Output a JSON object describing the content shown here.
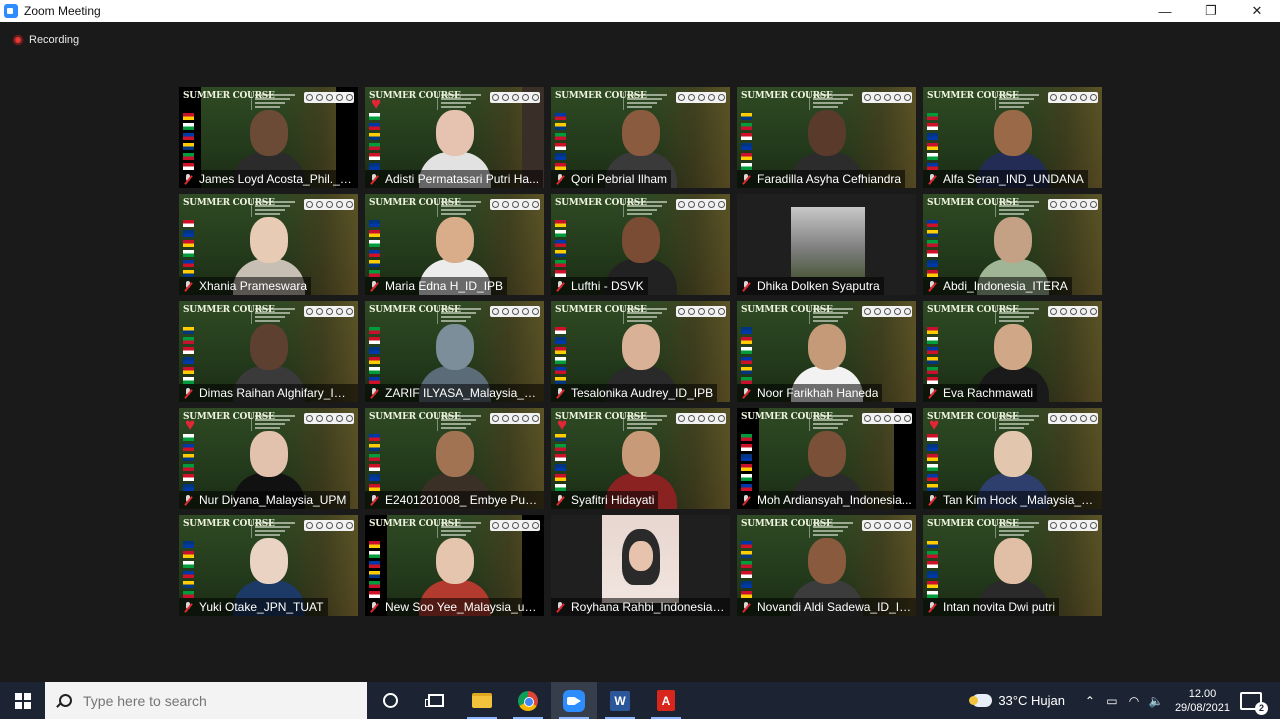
{
  "window": {
    "title": "Zoom Meeting",
    "minimize": "—",
    "restore": "❐",
    "close": "✕"
  },
  "recording": {
    "label": "Recording"
  },
  "participants": [
    {
      "name": "James Loyd Acosta_Phil._IS...",
      "heart": false,
      "active": false,
      "style": "sidebars",
      "skin": "#6b4a36",
      "shirt": "#2b2b2b"
    },
    {
      "name": "Adisti Permatasari Putri Ha...",
      "heart": true,
      "active": false,
      "style": "split",
      "skin": "#e6c3b0",
      "shirt": "#e2e2e2"
    },
    {
      "name": "Qori Pebrial Ilham",
      "heart": false,
      "active": false,
      "style": "bg",
      "skin": "#8a5b3e",
      "shirt": "#3a3a3a"
    },
    {
      "name": "Faradilla Asyha Cefhiandra",
      "heart": false,
      "active": true,
      "style": "bg",
      "skin": "#5a3a2a",
      "shirt": "#2c2c2c"
    },
    {
      "name": "Alfa Seran_IND_UNDANA",
      "heart": false,
      "active": false,
      "style": "bg",
      "skin": "#9a6a48",
      "shirt": "#222c55"
    },
    {
      "name": "Xhania Prameswara",
      "heart": false,
      "active": false,
      "style": "bg",
      "skin": "#e8cbb5",
      "shirt": "#c7bfb3"
    },
    {
      "name": "Maria Edna H_ID_IPB",
      "heart": false,
      "active": false,
      "style": "bg",
      "skin": "#d9ad8a",
      "shirt": "#ececec"
    },
    {
      "name": "Lufthi - DSVK",
      "heart": false,
      "active": false,
      "style": "bg",
      "skin": "#7a4c33",
      "shirt": "#222222"
    },
    {
      "name": "Dhika Dolken Syaputra",
      "heart": false,
      "active": false,
      "style": "photo"
    },
    {
      "name": "Abdi_Indonesia_ITERA",
      "heart": false,
      "active": false,
      "style": "bg",
      "skin": "#c4a184",
      "shirt": "#9fb595"
    },
    {
      "name": "Dimas Raihan Alghifary_ID_...",
      "heart": false,
      "active": false,
      "style": "bg",
      "skin": "#5e4030",
      "shirt": "#3a3a3a"
    },
    {
      "name": "ZARIF ILYASA_Malaysia_UPM",
      "heart": false,
      "active": false,
      "style": "bg",
      "skin": "#7b8e9a",
      "shirt": "#5b6b78"
    },
    {
      "name": "Tesalonika Audrey_ID_IPB",
      "heart": false,
      "active": false,
      "style": "bg",
      "skin": "#d9b196",
      "shirt": "#2a2a2a"
    },
    {
      "name": "Noor Farikhah Haneda",
      "heart": false,
      "active": false,
      "style": "bg",
      "skin": "#c59a79",
      "shirt": "#f2f2f2"
    },
    {
      "name": "Eva Rachmawati",
      "heart": false,
      "active": false,
      "style": "bg",
      "skin": "#d0a887",
      "shirt": "#1a1a1a"
    },
    {
      "name": "Nur Diyana_Malaysia_UPM",
      "heart": true,
      "active": false,
      "style": "bg",
      "skin": "#e3c2ad",
      "shirt": "#111111"
    },
    {
      "name": "E2401201008_ Embye Putri...",
      "heart": false,
      "active": false,
      "style": "bg",
      "skin": "#a27353",
      "shirt": "#3a3026"
    },
    {
      "name": "Syafitri Hidayati",
      "heart": true,
      "active": false,
      "style": "bg",
      "skin": "#c99a78",
      "shirt": "#8a2222"
    },
    {
      "name": "Moh Ardiansyah_Indonesia...",
      "heart": false,
      "active": false,
      "style": "sidebars",
      "skin": "#7a5038",
      "shirt": "#2b2b2b"
    },
    {
      "name": "Tan Kim Hock _Malaysia_U...",
      "heart": true,
      "active": false,
      "style": "bg",
      "skin": "#e3c6ae",
      "shirt": "#2e3f6e"
    },
    {
      "name": "Yuki Otake_JPN_TUAT",
      "heart": false,
      "active": false,
      "style": "bg",
      "skin": "#ead3c2",
      "shirt": "#1d3a66"
    },
    {
      "name": "New Soo Yee_Malaysia_upm",
      "heart": false,
      "active": false,
      "style": "sidebars-dark",
      "skin": "#e6c5ae",
      "shirt": "#b33a2e"
    },
    {
      "name": "Royhana Rahbi_Indonesia_...",
      "heart": false,
      "active": false,
      "style": "photo2"
    },
    {
      "name": "Novandi Aldi Sadewa_ID_IPB",
      "heart": false,
      "active": false,
      "style": "bg",
      "skin": "#8a5a3e",
      "shirt": "#3c3c3c"
    },
    {
      "name": "Intan novita Dwi putri",
      "heart": false,
      "active": false,
      "style": "bg",
      "skin": "#e0bfa6",
      "shirt": "#2a2a2a"
    }
  ],
  "banner": {
    "title": "SUMMER COURSE"
  },
  "colors": {
    "active_border": "#d6e84a",
    "mic_off": "#e0282e",
    "taskbar": "#1c2433"
  },
  "taskbar": {
    "search_placeholder": "Type here to search",
    "weather": "33°C  Hujan",
    "time": "12.00",
    "date": "29/08/2021",
    "notification_count": "2",
    "word_label": "W",
    "pdf_label": "A",
    "tray_chevron": "⌃",
    "tray_battery": "▭",
    "tray_wifi": "◠",
    "tray_volume": "🔈"
  }
}
